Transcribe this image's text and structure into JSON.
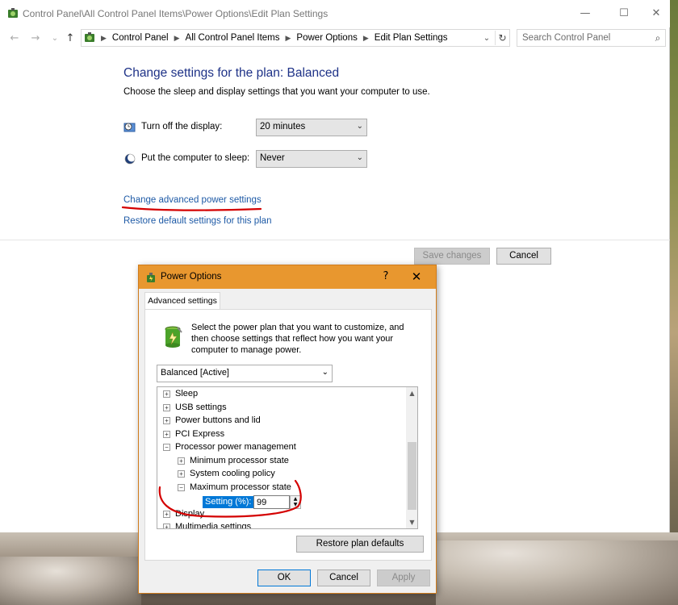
{
  "window": {
    "title": "Control Panel\\All Control Panel Items\\Power Options\\Edit Plan Settings",
    "minimize_glyph": "—",
    "maximize_glyph": "☐",
    "close_glyph": "✕"
  },
  "nav": {
    "back_glyph": "←",
    "forward_glyph": "→",
    "recent_glyph": "⌄",
    "up_glyph": "↑"
  },
  "breadcrumbs": [
    "Control Panel",
    "All Control Panel Items",
    "Power Options",
    "Edit Plan Settings"
  ],
  "address": {
    "dropdown_glyph": "⌄",
    "refresh_glyph": "↻"
  },
  "search": {
    "placeholder": "Search Control Panel",
    "icon_glyph": "⌕"
  },
  "page": {
    "heading": "Change settings for the plan: Balanced",
    "description": "Choose the sleep and display settings that you want your computer to use.",
    "display_label": "Turn off the display:",
    "display_value": "20 minutes",
    "sleep_label": "Put the computer to sleep:",
    "sleep_value": "Never",
    "advanced_link": "Change advanced power settings",
    "restore_link": "Restore default settings for this plan",
    "save_button": "Save changes",
    "cancel_button": "Cancel"
  },
  "dialog": {
    "title": "Power Options",
    "help_glyph": "?",
    "close_glyph": "✕",
    "tab": "Advanced settings",
    "intro": "Select the power plan that you want to customize, and then choose settings that reflect how you want your computer to manage power.",
    "plan_value": "Balanced [Active]",
    "tree": {
      "sleep": "Sleep",
      "usb": "USB settings",
      "power_buttons": "Power buttons and lid",
      "pci": "PCI Express",
      "processor": "Processor power management",
      "min_state": "Minimum processor state",
      "cooling": "System cooling policy",
      "max_state": "Maximum processor state",
      "setting_label": "Setting (%):",
      "setting_value": "99",
      "display": "Display",
      "multimedia": "Multimedia settings"
    },
    "restore_button": "Restore plan defaults",
    "ok_button": "OK",
    "cancel_button": "Cancel",
    "apply_button": "Apply"
  },
  "colors": {
    "heading": "#1e3287",
    "link": "#1e5aa6",
    "dialog_title": "#e8972f",
    "selection": "#0078d7",
    "annotation": "#d40000"
  }
}
